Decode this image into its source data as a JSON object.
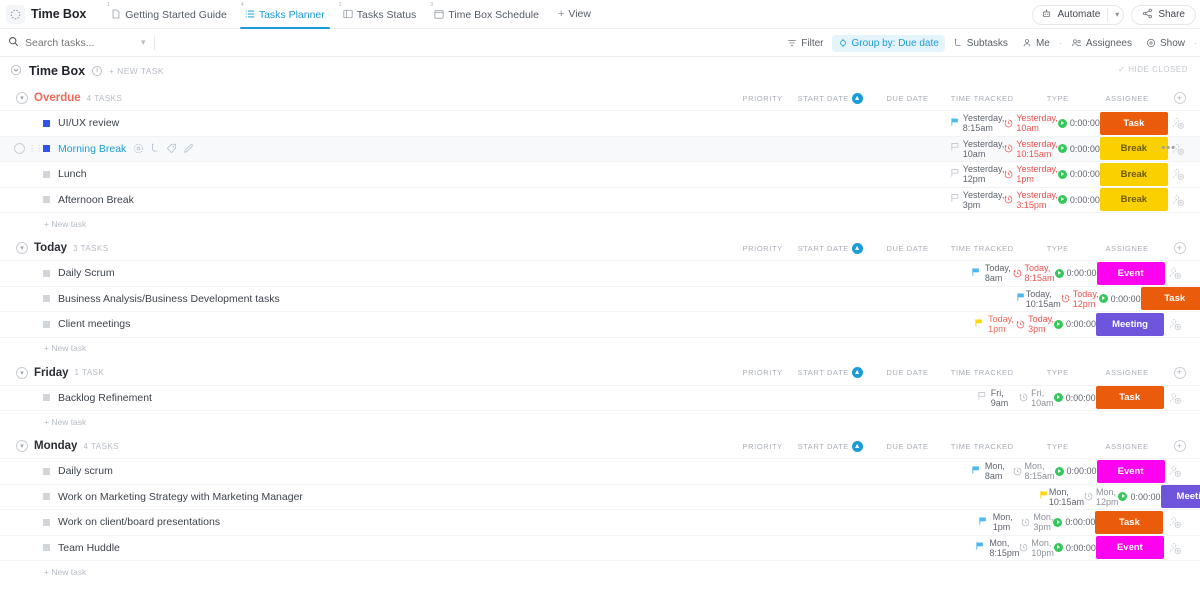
{
  "app": {
    "title": "Time Box",
    "logo_icon": "dotted-circle-icon"
  },
  "tabs": [
    {
      "label": "Getting Started Guide",
      "num": "1",
      "icon": "doc-icon",
      "active": false
    },
    {
      "label": "Tasks Planner",
      "num": "4",
      "icon": "list-icon",
      "active": true
    },
    {
      "label": "Tasks Status",
      "num": "2",
      "icon": "board-icon",
      "active": false
    },
    {
      "label": "Time Box Schedule",
      "num": "3",
      "icon": "calendar-icon",
      "active": false
    }
  ],
  "add_view": {
    "label": "View",
    "icon": "plus-icon"
  },
  "topbar_right": {
    "automate": {
      "label": "Automate",
      "icon": "robot-icon",
      "chevron": "chevron-down-icon"
    },
    "share": {
      "label": "Share",
      "icon": "share-icon"
    }
  },
  "search": {
    "placeholder": "Search tasks...",
    "value": "",
    "icon": "search-icon",
    "chevron": "chevron-down-icon"
  },
  "toolbar": {
    "items": [
      {
        "label": "Filter",
        "icon": "filter-icon",
        "highlight": false
      },
      {
        "label": "Group by: Due date",
        "icon": "group-icon",
        "highlight": true
      },
      {
        "label": "Subtasks",
        "icon": "subtask-icon",
        "highlight": false
      },
      {
        "label": "Me",
        "icon": "person-icon",
        "highlight": false
      },
      {
        "label": "Assignees",
        "icon": "people-icon",
        "highlight": false
      },
      {
        "label": "Show",
        "icon": "eye-icon",
        "highlight": false
      }
    ]
  },
  "list_header": {
    "caret": "chevron-down-icon",
    "name": "Time Box",
    "info_icon": "info-icon",
    "new_task": "+ NEW TASK",
    "hide_closed": "HIDE CLOSED",
    "hide_closed_icon": "check-icon"
  },
  "columns": [
    {
      "key": "priority",
      "label": "Priority"
    },
    {
      "key": "start",
      "label": "Start date",
      "sorted": true,
      "sort_icon": "arrow-up-icon"
    },
    {
      "key": "due",
      "label": "Due date"
    },
    {
      "key": "tracked",
      "label": "Time tracked"
    },
    {
      "key": "type",
      "label": "Type"
    },
    {
      "key": "assignee",
      "label": "Assignee"
    },
    {
      "key": "add",
      "label": "",
      "add_icon": "plus-circle-icon"
    }
  ],
  "colors": {
    "accent": "#1b9cd8",
    "overdue": "#ef5350",
    "task": "#ea5b0c",
    "break": "#fad000",
    "event": "#ff02f0",
    "meeting": "#6e55dc",
    "track_green": "#34c759",
    "flag_blue": "#4bb8f0",
    "flag_yellow": "#ffd60a",
    "flag_grey": "#c9ced4",
    "status_blue": "#2f54eb",
    "status_grey": "#d2d6db"
  },
  "new_task_label": "+ New task",
  "groups": [
    {
      "name": "Overdue",
      "name_color": "#f06a5a",
      "count": "4 TASKS",
      "tasks": [
        {
          "name": "UI/UX review",
          "status_color": "#2f54eb",
          "flag": "blue",
          "start": "Yesterday, 8:15am",
          "start_overdue": false,
          "due": "Yesterday, 10am",
          "due_overdue": true,
          "tracked": "0:00:00",
          "type": "Task",
          "type_color": "#ea5b0c",
          "type_text_color": "#ffffff",
          "hovered": false
        },
        {
          "name": "Morning Break",
          "status_color": "#2f54eb",
          "flag": "grey",
          "start": "Yesterday, 10am",
          "start_overdue": false,
          "due": "Yesterday, 10:15am",
          "due_overdue": true,
          "tracked": "0:00:00",
          "type": "Break",
          "type_color": "#fad000",
          "type_text_color": "#6b5a00",
          "hovered": true,
          "hover_icons": [
            "expand-circle-icon",
            "subtask-icon",
            "tag-icon",
            "edit-icon"
          ],
          "menu_icon": "ellipsis-icon"
        },
        {
          "name": "Lunch",
          "status_color": "#d2d6db",
          "flag": "grey",
          "start": "Yesterday, 12pm",
          "start_overdue": false,
          "due": "Yesterday, 1pm",
          "due_overdue": true,
          "tracked": "0:00:00",
          "type": "Break",
          "type_color": "#fad000",
          "type_text_color": "#6b5a00",
          "hovered": false
        },
        {
          "name": "Afternoon Break",
          "status_color": "#d2d6db",
          "flag": "grey",
          "start": "Yesterday, 3pm",
          "start_overdue": false,
          "due": "Yesterday, 3:15pm",
          "due_overdue": true,
          "tracked": "0:00:00",
          "type": "Break",
          "type_color": "#fad000",
          "type_text_color": "#6b5a00",
          "hovered": false
        }
      ]
    },
    {
      "name": "Today",
      "name_color": "#2a2e34",
      "count": "3 TASKS",
      "tasks": [
        {
          "name": "Daily Scrum",
          "status_color": "#d2d6db",
          "flag": "blue",
          "start": "Today, 8am",
          "start_overdue": false,
          "due": "Today, 8:15am",
          "due_overdue": true,
          "tracked": "0:00:00",
          "type": "Event",
          "type_color": "#ff02f0",
          "type_text_color": "#ffffff",
          "hovered": false
        },
        {
          "name": "Business Analysis/Business Development tasks",
          "status_color": "#d2d6db",
          "flag": "blue",
          "start": "Today, 10:15am",
          "start_overdue": false,
          "due": "Today, 12pm",
          "due_overdue": true,
          "tracked": "0:00:00",
          "type": "Task",
          "type_color": "#ea5b0c",
          "type_text_color": "#ffffff",
          "hovered": false
        },
        {
          "name": "Client meetings",
          "status_color": "#d2d6db",
          "flag": "yellow",
          "start": "Today, 1pm",
          "start_overdue": true,
          "due": "Today, 3pm",
          "due_overdue": true,
          "tracked": "0:00:00",
          "type": "Meeting",
          "type_color": "#6e55dc",
          "type_text_color": "#ffffff",
          "hovered": false
        }
      ]
    },
    {
      "name": "Friday",
      "name_color": "#2a2e34",
      "count": "1 TASK",
      "tasks": [
        {
          "name": "Backlog Refinement",
          "status_color": "#d2d6db",
          "flag": "grey",
          "start": "Fri, 9am",
          "start_overdue": false,
          "due": "Fri, 10am",
          "due_overdue": false,
          "tracked": "0:00:00",
          "type": "Task",
          "type_color": "#ea5b0c",
          "type_text_color": "#ffffff",
          "hovered": false
        }
      ]
    },
    {
      "name": "Monday",
      "name_color": "#2a2e34",
      "count": "4 TASKS",
      "tasks": [
        {
          "name": "Daily scrum",
          "status_color": "#d2d6db",
          "flag": "blue",
          "start": "Mon, 8am",
          "start_overdue": false,
          "due": "Mon, 8:15am",
          "due_overdue": false,
          "tracked": "0:00:00",
          "type": "Event",
          "type_color": "#ff02f0",
          "type_text_color": "#ffffff",
          "hovered": false
        },
        {
          "name": "Work on Marketing Strategy with Marketing Manager",
          "status_color": "#d2d6db",
          "flag": "yellow",
          "start": "Mon, 10:15am",
          "start_overdue": false,
          "due": "Mon, 12pm",
          "due_overdue": false,
          "tracked": "0:00:00",
          "type": "Meeting",
          "type_color": "#6e55dc",
          "type_text_color": "#ffffff",
          "hovered": false
        },
        {
          "name": "Work on client/board presentations",
          "status_color": "#d2d6db",
          "flag": "blue",
          "start": "Mon, 1pm",
          "start_overdue": false,
          "due": "Mon, 3pm",
          "due_overdue": false,
          "tracked": "0:00:00",
          "type": "Task",
          "type_color": "#ea5b0c",
          "type_text_color": "#ffffff",
          "hovered": false
        },
        {
          "name": "Team Huddle",
          "status_color": "#d2d6db",
          "flag": "blue",
          "start": "Mon, 8:15pm",
          "start_overdue": false,
          "due": "Mon, 10pm",
          "due_overdue": false,
          "tracked": "0:00:00",
          "type": "Event",
          "type_color": "#ff02f0",
          "type_text_color": "#ffffff",
          "hovered": false
        }
      ]
    }
  ]
}
